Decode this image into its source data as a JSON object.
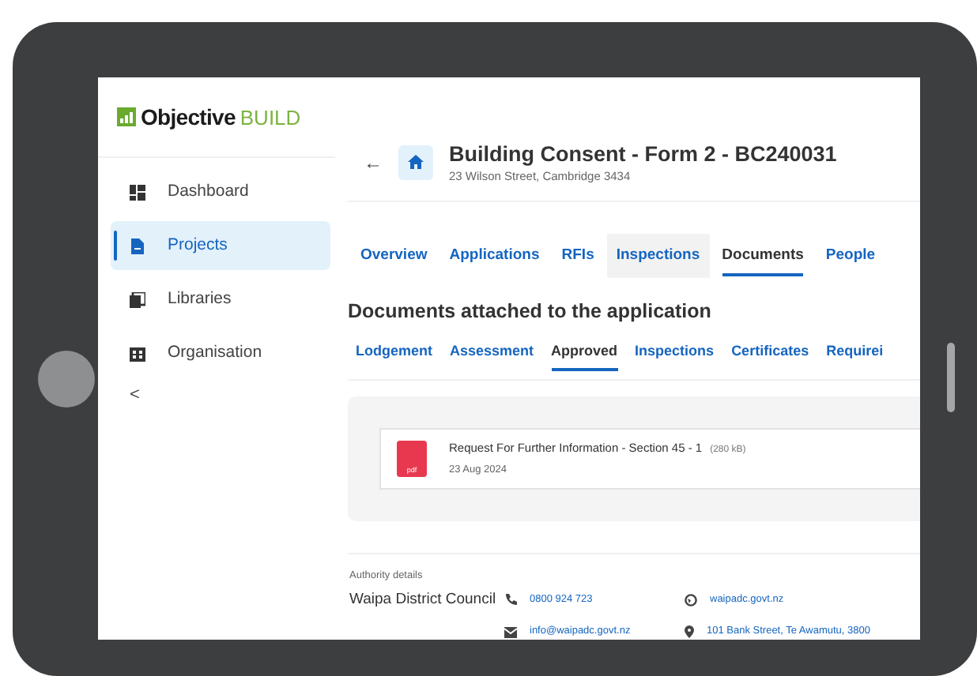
{
  "logo": {
    "brand": "Objective",
    "product": "BUILD"
  },
  "sidebar": {
    "items": [
      {
        "label": "Dashboard",
        "kind": "dashboard",
        "selected": false
      },
      {
        "label": "Projects",
        "kind": "file",
        "selected": true
      },
      {
        "label": "Libraries",
        "kind": "library",
        "selected": false
      },
      {
        "label": "Organisation",
        "kind": "building",
        "selected": false
      }
    ],
    "collapse": "<"
  },
  "header": {
    "back": "←",
    "title": "Building Consent - Form 2 - BC240031",
    "subtitle": "23 Wilson Street, Cambridge 3434"
  },
  "tabs": [
    {
      "label": "Overview",
      "selected": false,
      "hovered": false
    },
    {
      "label": "Applications",
      "selected": false,
      "hovered": false
    },
    {
      "label": "RFIs",
      "selected": false,
      "hovered": false
    },
    {
      "label": "Inspections",
      "selected": false,
      "hovered": true
    },
    {
      "label": "Documents",
      "selected": true,
      "hovered": false
    },
    {
      "label": "People",
      "selected": false,
      "hovered": false
    }
  ],
  "section_title": "Documents attached to the application",
  "subtabs": [
    {
      "label": "Lodgement",
      "selected": false
    },
    {
      "label": "Assessment",
      "selected": false
    },
    {
      "label": "Approved",
      "selected": true
    },
    {
      "label": "Inspections",
      "selected": false
    },
    {
      "label": "Certificates",
      "selected": false
    },
    {
      "label": "Requirei",
      "selected": false
    }
  ],
  "documents": [
    {
      "file_type": "pdf",
      "name": "Request For Further Information - Section 45 - 1",
      "size": "(280 kB)",
      "date": "23 Aug 2024"
    }
  ],
  "authority": {
    "label": "Authority details",
    "name": "Waipa District Council",
    "phone": "0800 924 723",
    "email": "info@waipadc.govt.nz",
    "website": "waipadc.govt.nz",
    "address": "101 Bank Street, Te Awamutu, 3800"
  }
}
